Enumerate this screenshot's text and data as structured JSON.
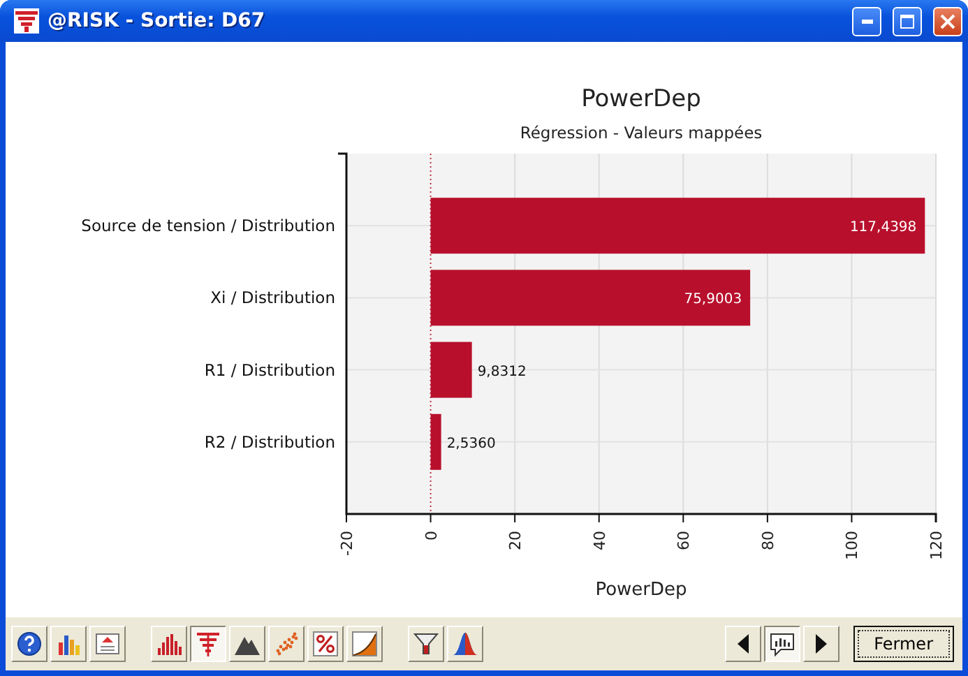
{
  "window": {
    "title": "@RISK - Sortie: D67"
  },
  "chart": {
    "chart_data": {
      "type": "bar",
      "orientation": "horizontal",
      "title": "PowerDep",
      "subtitle": "Régression - Valeurs mappées",
      "xlabel": "PowerDep",
      "categories": [
        "Source de tension / Distribution",
        "Xi / Distribution",
        "R1 / Distribution",
        "R2 / Distribution"
      ],
      "series": [
        {
          "color": "#b8102c",
          "values": [
            117.4,
            75.9,
            9.8,
            2.5
          ]
        }
      ],
      "grid": true,
      "ref_lines": [
        {
          "axis": "x",
          "value": 0,
          "color": "#c03040"
        }
      ],
      "value_labels": [
        "117,4398",
        "75,9003",
        "9,8312",
        "2,5360"
      ],
      "xlim": [
        -20,
        120
      ],
      "xticks": [
        -20,
        0,
        20,
        40,
        60,
        80,
        100,
        120
      ]
    }
  },
  "toolbar": {
    "items": [
      {
        "kind": "help",
        "selected": false
      },
      {
        "kind": "charttype",
        "selected": false
      },
      {
        "kind": "report",
        "selected": false
      },
      {
        "kind": "histogram",
        "selected": false
      },
      {
        "kind": "tornado",
        "selected": true
      },
      {
        "kind": "area",
        "selected": false
      },
      {
        "kind": "scatter",
        "selected": false
      },
      {
        "kind": "percent",
        "selected": false
      },
      {
        "kind": "cumulative",
        "selected": false
      },
      {
        "kind": "filter",
        "selected": false
      },
      {
        "kind": "normal",
        "selected": false
      }
    ],
    "nav": [
      {
        "kind": "prev",
        "selected": false
      },
      {
        "kind": "comment",
        "selected": true
      },
      {
        "kind": "next",
        "selected": false
      }
    ],
    "close_button": "Fermer"
  }
}
